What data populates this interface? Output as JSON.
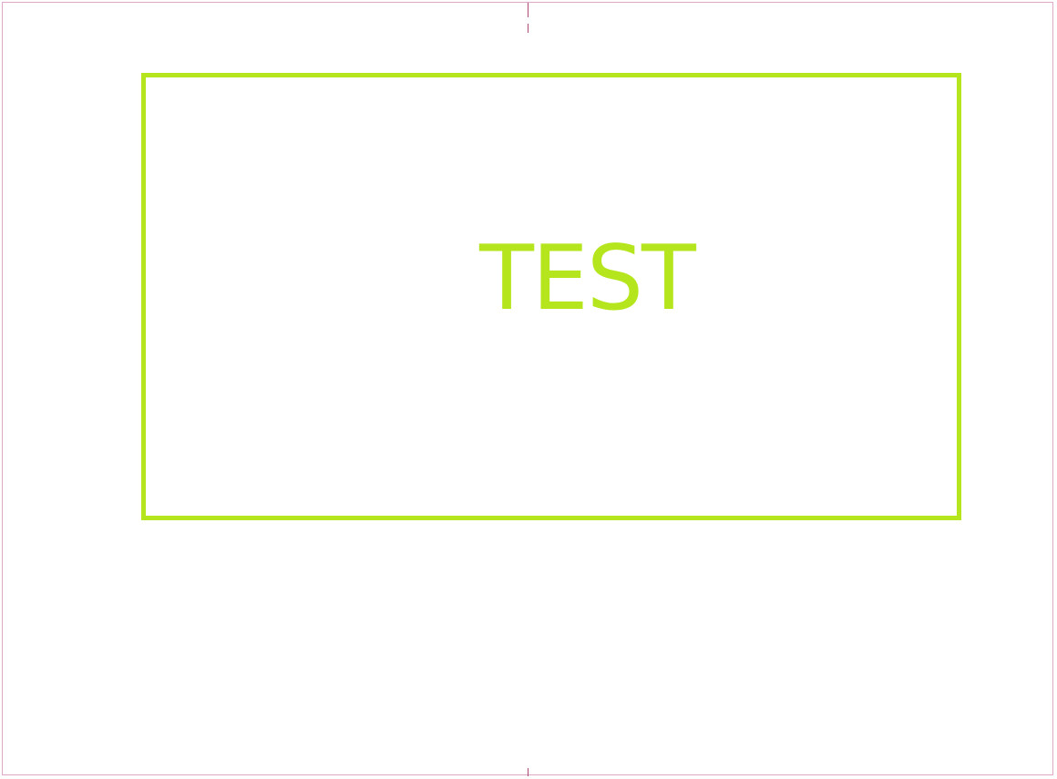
{
  "box": {
    "label": "TEST",
    "color": "#b5e61d"
  },
  "frame": {
    "color": "#e0a8c8",
    "mark_color": "#b04878"
  }
}
